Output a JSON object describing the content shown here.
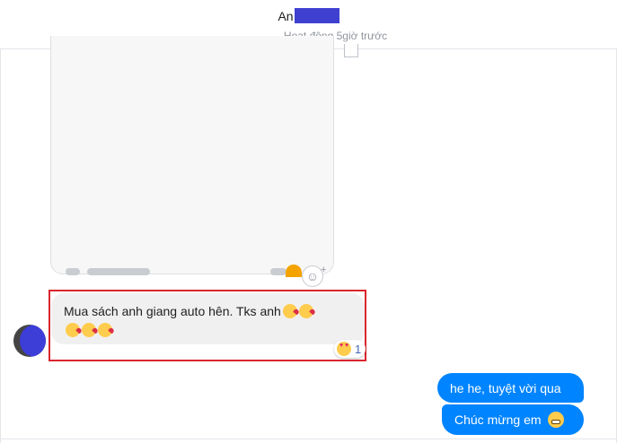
{
  "header": {
    "name_visible": "An",
    "status": "Hoạt động 5giờ trước"
  },
  "messages": {
    "incoming": {
      "text": "Mua sách anh giang auto hên. Tks anh",
      "emoji": "kissing-heart-emoji",
      "reaction_emoji": "heart-eyes-emoji",
      "reaction_count": "1"
    },
    "outgoing": [
      {
        "text": "he he, tuyệt vời qua"
      },
      {
        "text": "Chúc mừng em",
        "emoji": "grimacing-emoji"
      }
    ]
  },
  "colors": {
    "outgoing_bubble": "#0084ff",
    "incoming_bubble": "#f1f0f0",
    "highlight_border": "#d9262e",
    "redaction": "#3f3fd0"
  }
}
